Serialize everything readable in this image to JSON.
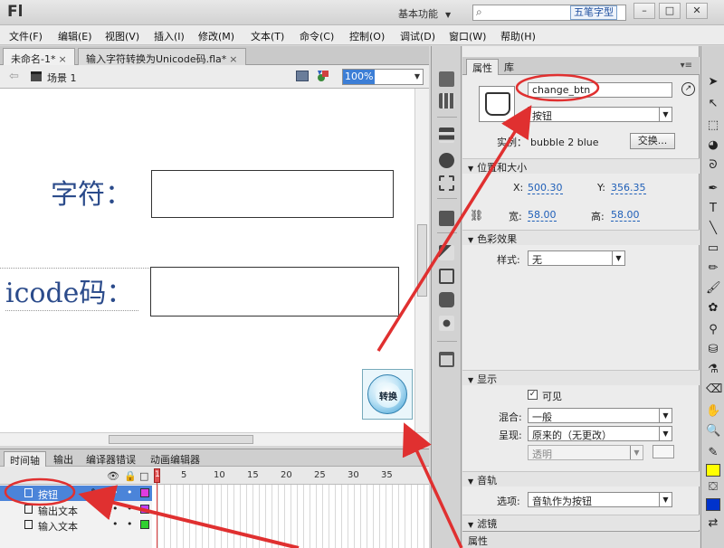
{
  "titlebar": {
    "app_logo": "Fl",
    "workspace": "基本功能",
    "search_placeholder": "",
    "ime_label": "五笔字型",
    "win_min": "–",
    "win_max": "□",
    "win_close": "✕"
  },
  "menu": [
    "文件(F)",
    "编辑(E)",
    "视图(V)",
    "插入(I)",
    "修改(M)",
    "文本(T)",
    "命令(C)",
    "控制(O)",
    "调试(D)",
    "窗口(W)",
    "帮助(H)"
  ],
  "doc_tabs": [
    {
      "label": "未命名-1*",
      "close": "×"
    },
    {
      "label": "输入字符转换为Unicode码.fla*",
      "close": "×"
    }
  ],
  "editbar": {
    "scene": "场景 1",
    "zoom": "100%"
  },
  "stage": {
    "label_char": "字符：",
    "label_unicode": "icode码：",
    "button_text": "转换"
  },
  "timeline": {
    "tabs": [
      "时间轴",
      "输出",
      "编译器错误",
      "动画编辑器"
    ],
    "frame_numbers": [
      "1",
      "5",
      "10",
      "15",
      "20",
      "25",
      "30",
      "35"
    ],
    "layers": [
      {
        "name": "按钮",
        "selected": true,
        "color": "#e03ce0"
      },
      {
        "name": "输出文本",
        "selected": false,
        "color": "#c040ff"
      },
      {
        "name": "输入文本",
        "selected": false,
        "color": "#30d030"
      }
    ]
  },
  "properties": {
    "tabs": [
      "属性",
      "库"
    ],
    "instance_name": "change_btn",
    "symbol_type": "按钮",
    "instance_label": "实例：",
    "instance_of": "bubble 2 blue",
    "swap_label": "交换...",
    "sections": {
      "position_size": "位置和大小",
      "color_effect": "色彩效果",
      "display": "显示",
      "tracking": "音轨",
      "filters": "滤镜"
    },
    "x_label": "X:",
    "x_value": "500.30",
    "y_label": "Y:",
    "y_value": "356.35",
    "width_label": "宽:",
    "width_value": "58.00",
    "height_label": "高:",
    "height_value": "58.00",
    "style_label": "样式:",
    "style_value": "无",
    "visible_label": "可见",
    "blend_label": "混合:",
    "blend_value": "一般",
    "render_label": "呈现:",
    "render_value": "原来的（无更改）",
    "transparent_value": "透明",
    "track_label": "选项:",
    "track_value": "音轨作为按钮",
    "bottom_tab": "属性"
  },
  "colors": {
    "selection_blue": "#4b84d9",
    "annotation_red": "#e03030",
    "text_blue": "#2b4b8b"
  }
}
